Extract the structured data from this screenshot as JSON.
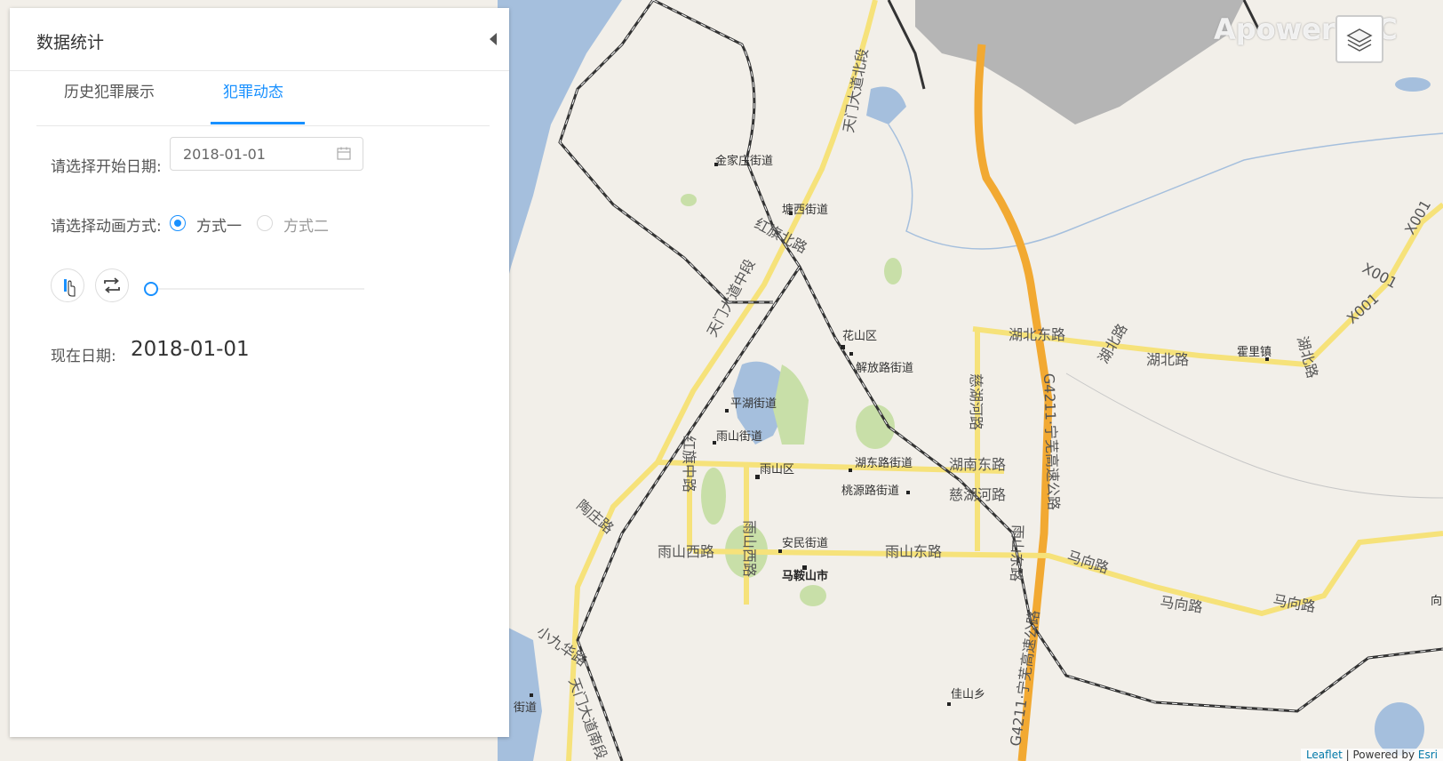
{
  "panel": {
    "title": "数据统计",
    "tabs": [
      {
        "label": "历史犯罪展示",
        "active": false
      },
      {
        "label": "犯罪动态",
        "active": true
      }
    ],
    "start_date_label": "请选择开始日期:",
    "start_date_value": "2018-01-01",
    "animation_mode_label": "请选择动画方式:",
    "animation_options": [
      {
        "label": "方式一",
        "selected": true
      },
      {
        "label": "方式二",
        "selected": false
      }
    ],
    "current_date_label": "现在日期:",
    "current_date_value": "2018-01-01",
    "slider_progress": 0
  },
  "icons": {
    "collapse": "caret-left-icon",
    "calendar": "calendar-icon",
    "play": "play-pause-icon",
    "loop": "loop-icon",
    "layers": "layers-icon"
  },
  "map": {
    "labels": {
      "tianmen_north": "天门大道北段",
      "jinjiazhuang": "金家庄街道",
      "tangxi": "塘西街道",
      "hongqi_north": "红旗北路",
      "tianmen_middle": "天门大道中段",
      "huashan": "花山区",
      "jiefang": "解放路街道",
      "pinghu": "平湖街道",
      "yushan_street": "雨山街道",
      "yushan_district": "雨山区",
      "hongqi_middle": "红旗中路",
      "hudong": "湖东路街道",
      "taoyuan": "桃源路街道",
      "hunan_east": "湖南东路",
      "cihu_river_road": "慈湖河路",
      "cihu_river_vertical": "慈湖河路",
      "hubei_east": "湖北东路",
      "hubei_road_1": "湖北路",
      "hubei_road_2": "湖北路",
      "hubei_road_3": "湖北路",
      "huoli": "霍里镇",
      "x001_a": "X001",
      "x001_b": "X001",
      "x001_c": "X001",
      "g4211_north": "G4211·宁芜高速公路",
      "g4211_south": "G4211·宁芜高速公路",
      "taozhuang": "陶庄路",
      "yushan_west": "雨山西路",
      "yushan_west_v": "雨山西路",
      "anmin": "安民街道",
      "yushan_east": "雨山东路",
      "maanshan": "马鞍山市",
      "yushan_east_v": "雨山东路",
      "maxiang_1": "马向路",
      "maxiang_2": "马向路",
      "maxiang_3": "马向路",
      "xiaojiuhua": "小九华路",
      "tianmen_south": "天门大道南段",
      "jiashan": "佳山乡",
      "street_edge": "街道",
      "edge_fragment": "向"
    },
    "watermark": "ApowerREC",
    "attribution_leaflet": "Leaflet",
    "attribution_sep": "| Powered by",
    "attribution_esri": "Esri"
  }
}
